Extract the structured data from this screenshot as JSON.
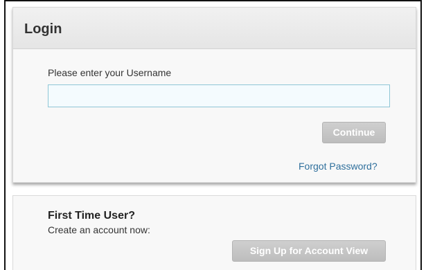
{
  "login": {
    "title": "Login",
    "username_label": "Please enter your Username",
    "username_value": "",
    "continue_label": "Continue",
    "forgot_password_label": "Forgot Password?"
  },
  "signup": {
    "title": "First Time User?",
    "subtitle": "Create an account now:",
    "button_label": "Sign Up for Account View"
  },
  "colors": {
    "link": "#2e6f9c",
    "input_border": "#8fc6d6",
    "button_disabled": "#c7c7c7"
  }
}
